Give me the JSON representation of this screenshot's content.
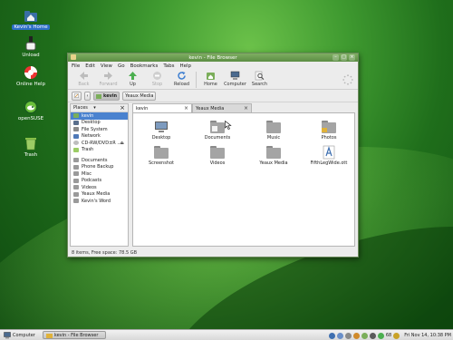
{
  "desktop": {
    "icons": [
      {
        "label": "Kevin's Home",
        "icon": "home-folder-icon"
      },
      {
        "label": "Unload",
        "icon": "unload-icon"
      },
      {
        "label": "Online Help",
        "icon": "help-lifebuoy-icon"
      },
      {
        "label": "openSUSE",
        "icon": "opensuse-logo-icon"
      },
      {
        "label": "Trash",
        "icon": "trash-icon"
      }
    ]
  },
  "window": {
    "title": "kevin - File Browser",
    "menu": [
      "File",
      "Edit",
      "View",
      "Go",
      "Bookmarks",
      "Tabs",
      "Help"
    ],
    "toolbar": [
      {
        "label": "Back",
        "icon": "back-arrow-icon",
        "enabled": false
      },
      {
        "label": "Forward",
        "icon": "forward-arrow-icon",
        "enabled": false
      },
      {
        "label": "Up",
        "icon": "up-arrow-icon",
        "enabled": true
      },
      {
        "label": "Stop",
        "icon": "stop-icon",
        "enabled": false
      },
      {
        "label": "Reload",
        "icon": "reload-icon",
        "enabled": true
      },
      {
        "label": "Home",
        "icon": "home-icon",
        "enabled": true
      },
      {
        "label": "Computer",
        "icon": "computer-icon",
        "enabled": true
      },
      {
        "label": "Search",
        "icon": "search-icon",
        "enabled": true
      }
    ],
    "location": {
      "current": "kevin",
      "other": "Yeaux Media"
    },
    "sidebar": {
      "header": "Places",
      "places": [
        {
          "label": "kevin",
          "icon": "home-folder-icon"
        },
        {
          "label": "Desktop",
          "icon": "desktop-icon"
        },
        {
          "label": "File System",
          "icon": "drive-icon"
        },
        {
          "label": "Network",
          "icon": "network-icon"
        },
        {
          "label": "CD-RW/DVD±R ...",
          "icon": "optical-drive-icon"
        },
        {
          "label": "Trash",
          "icon": "trash-icon"
        }
      ],
      "bookmarks": [
        {
          "label": "Documents"
        },
        {
          "label": "Phone Backup"
        },
        {
          "label": "Misc"
        },
        {
          "label": "Podcasts"
        },
        {
          "label": "Videos"
        },
        {
          "label": "Yeaux Media"
        },
        {
          "label": "Kevin's Word"
        }
      ]
    },
    "tabs": [
      {
        "label": "kevin",
        "active": true
      },
      {
        "label": "Yeaux Media",
        "active": false
      }
    ],
    "files": [
      {
        "name": "Desktop",
        "icon": "desktop-folder-icon"
      },
      {
        "name": "Documents",
        "icon": "documents-folder-icon"
      },
      {
        "name": "Music",
        "icon": "music-folder-icon"
      },
      {
        "name": "Photos",
        "icon": "photos-folder-icon"
      },
      {
        "name": "Screenshot",
        "icon": "folder-icon"
      },
      {
        "name": "Videos",
        "icon": "folder-icon"
      },
      {
        "name": "Yeaux Media",
        "icon": "folder-icon"
      },
      {
        "name": "FifthLegWide.ott",
        "icon": "font-file-icon"
      }
    ],
    "status": "8 items, Free space: 78.5 GB"
  },
  "panel": {
    "computer_label": "Computer",
    "task_label": "kevin - File Browser",
    "clock": "Fri Nov 14, 10:38 PM",
    "battery": "68"
  },
  "colors": {
    "accent": "#4a82cf",
    "titlebar": "#5b8d43"
  }
}
